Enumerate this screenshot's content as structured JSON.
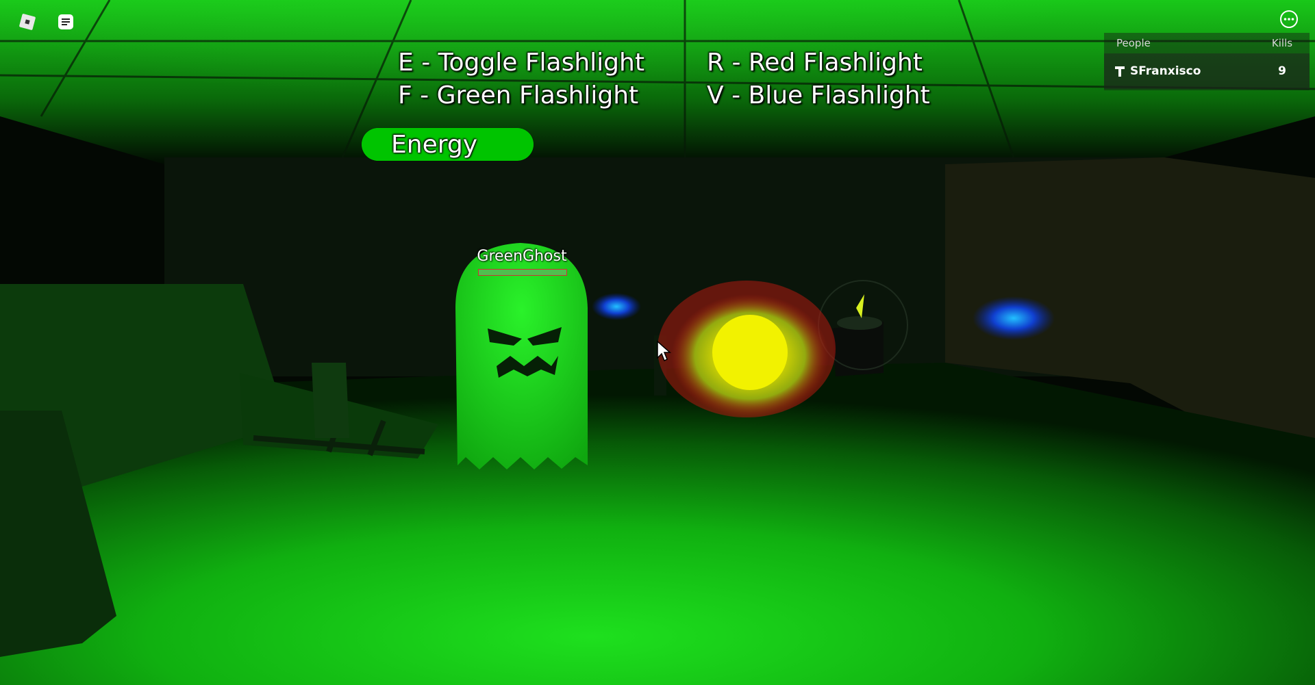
{
  "hints": {
    "toggle": "E - Toggle Flashlight",
    "green": "F - Green Flashlight",
    "red": "R - Red Flashlight",
    "blue": "V - Blue Flashlight"
  },
  "energy": {
    "label": "Energy",
    "level": 1.0
  },
  "leaderboard": {
    "col_people": "People",
    "col_kills": "Kills",
    "rows": [
      {
        "name": "SFranxisco",
        "kills": "9"
      }
    ]
  },
  "ghost": {
    "name": "GreenGhost",
    "health": 1.0
  },
  "icons": {
    "logo": "roblox-logo-icon",
    "chat": "chat-icon",
    "menu": "more-options-icon",
    "player": "player-icon"
  },
  "colors": {
    "flashlight_green": "#00e000",
    "energy_bar": "#00c400"
  }
}
